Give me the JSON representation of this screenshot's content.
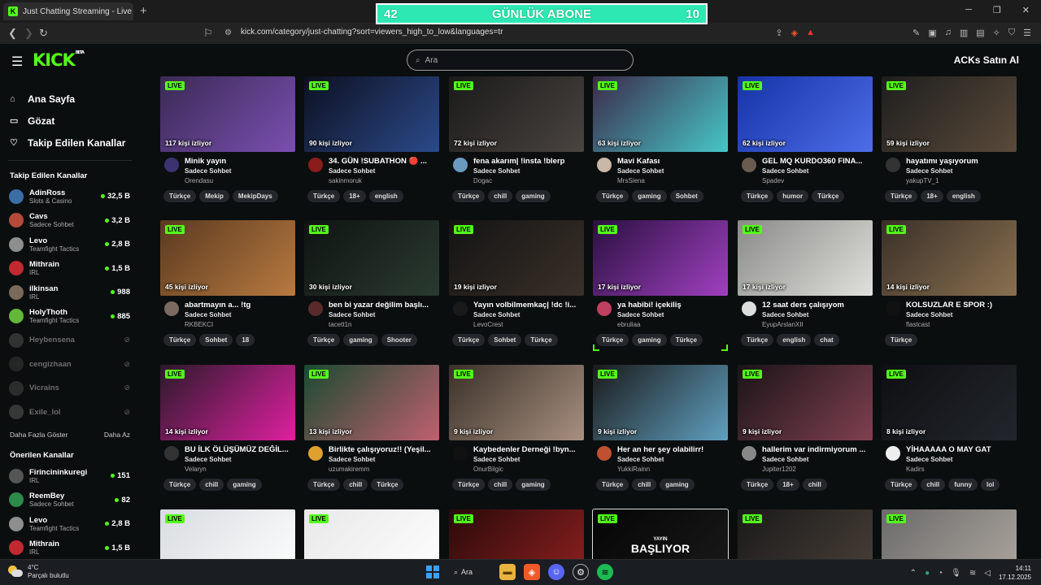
{
  "browser": {
    "tab_title": "Just Chatting Streaming - Live St",
    "favicon_letter": "K",
    "new_tab": "+",
    "url": "kick.com/category/just-chatting?sort=viewers_high_to_low&languages=tr",
    "window": {
      "minimize": "─",
      "restore": "❐",
      "close": "✕"
    }
  },
  "overlay_banner": {
    "left": "42",
    "label": "GÜNLÜK ABONE",
    "right": "10"
  },
  "site": {
    "logo": "KICK",
    "logo_sup": "BETA",
    "search_placeholder": "Ara",
    "user": "ACKs Satın Al"
  },
  "sidebar": {
    "nav": [
      {
        "label": "Ana Sayfa",
        "icon": "home-icon"
      },
      {
        "label": "Gözat",
        "icon": "browse-icon"
      },
      {
        "label": "Takip Edilen Kanallar",
        "icon": "heart-icon"
      }
    ],
    "followed_heading": "Takip Edilen Kanallar",
    "followed": [
      {
        "name": "AdinRoss",
        "category": "Slots & Casino",
        "viewers": "32,5 B",
        "color": "#3a6ea5"
      },
      {
        "name": "Cavs",
        "category": "Sadece Sohbet",
        "viewers": "3,2 B",
        "color": "#b54a3a"
      },
      {
        "name": "Levo",
        "category": "Teamfight Tactics",
        "viewers": "2,8 B",
        "color": "#8e8e8e"
      },
      {
        "name": "Mithrain",
        "category": "IRL",
        "viewers": "1,5 B",
        "color": "#c0292f"
      },
      {
        "name": "ilkinsan",
        "category": "IRL",
        "viewers": "988",
        "color": "#7a6a5a"
      },
      {
        "name": "HolyThoth",
        "category": "Teamfight Tactics",
        "viewers": "885",
        "color": "#62b83a"
      }
    ],
    "offline": [
      {
        "name": "Heybensena",
        "color": "#777"
      },
      {
        "name": "cengizhaan",
        "color": "#555"
      },
      {
        "name": "Vicrains",
        "color": "#666"
      },
      {
        "name": "Exile_lol",
        "color": "#888"
      }
    ],
    "show_more": "Daha Fazla Göster",
    "show_less": "Daha Az",
    "recommended_heading": "Önerilen Kanallar",
    "recommended": [
      {
        "name": "Firincininkuregi",
        "category": "IRL",
        "viewers": "151",
        "color": "#555"
      },
      {
        "name": "ReemBey",
        "category": "Sadece Sohbet",
        "viewers": "82",
        "color": "#2c8a4a"
      },
      {
        "name": "Levo",
        "category": "Teamfight Tactics",
        "viewers": "2,8 B",
        "color": "#8e8e8e"
      },
      {
        "name": "Mithrain",
        "category": "IRL",
        "viewers": "1,5 B",
        "color": "#c0292f"
      }
    ]
  },
  "live_label": "LIVE",
  "streams": [
    {
      "viewers": "117 kişi izliyor",
      "title": "Minik yayın",
      "category": "Sadece Sohbet",
      "user": "Orendasu",
      "tags": [
        "Türkçe",
        "Mekip",
        "MekipDays"
      ],
      "thumb": [
        "#3a2a55",
        "#7a4fb0"
      ],
      "avatar": "#3b3370"
    },
    {
      "viewers": "90 kişi izliyor",
      "title": "34. GÜN !SUBATHON 🔴 ...",
      "category": "Sadece Sohbet",
      "user": "sakinmoruk",
      "tags": [
        "Türkçe",
        "18+",
        "english"
      ],
      "thumb": [
        "#0d1020",
        "#2b4a8a"
      ],
      "avatar": "#8a1c1c"
    },
    {
      "viewers": "72 kişi izliyor",
      "title": "fena akarım| !insta !blerp",
      "category": "Sadece Sohbet",
      "user": "Dogac",
      "tags": [
        "Türkçe",
        "chill",
        "gaming"
      ],
      "thumb": [
        "#1a1a1a",
        "#4a4440"
      ],
      "avatar": "#6a9ac0"
    },
    {
      "viewers": "63 kişi izliyor",
      "title": "Mavi Kafası",
      "category": "Sadece Sohbet",
      "user": "MrsSiena",
      "tags": [
        "Türkçe",
        "gaming",
        "Sohbet"
      ],
      "thumb": [
        "#3c2a4a",
        "#46c6c8"
      ],
      "avatar": "#c9b7a7"
    },
    {
      "viewers": "62 kişi izliyor",
      "title": "GEL MQ KURDO360 FINA...",
      "category": "Sadece Sohbet",
      "user": "Spadev",
      "tags": [
        "Türkçe",
        "humor",
        "Türkçe"
      ],
      "thumb": [
        "#1633a8",
        "#4d6ee8"
      ],
      "avatar": "#6a5a50"
    },
    {
      "viewers": "59 kişi izliyor",
      "title": "hayatımı yaşıyorum",
      "category": "Sadece Sohbet",
      "user": "yakupTV_1",
      "tags": [
        "Türkçe",
        "18+",
        "english"
      ],
      "thumb": [
        "#1e1e1e",
        "#5a4a3a"
      ],
      "avatar": "#333"
    },
    {
      "viewers": "45 kişi izliyor",
      "title": "abartmayın a... !tg",
      "category": "Sadece Sohbet",
      "user": "RKBEKCI",
      "tags": [
        "Türkçe",
        "Sohbet",
        "18"
      ],
      "thumb": [
        "#5a3a20",
        "#b87a40"
      ],
      "avatar": "#7a6a60"
    },
    {
      "viewers": "30 kişi izliyor",
      "title": "ben bi yazar değilim başlı...",
      "category": "Sadece Sohbet",
      "user": "tacett1n",
      "tags": [
        "Türkçe",
        "gaming",
        "Shooter"
      ],
      "thumb": [
        "#0f1412",
        "#2a3a30"
      ],
      "avatar": "#5a2a2a"
    },
    {
      "viewers": "19 kişi izliyor",
      "title": "Yayın volbilmemkaç| !dc !i...",
      "category": "Sadece Sohbet",
      "user": "LevoCrest",
      "tags": [
        "Türkçe",
        "Sohbet",
        "Türkçe"
      ],
      "thumb": [
        "#141414",
        "#3a3028"
      ],
      "avatar": "#1a1a1a"
    },
    {
      "viewers": "17 kişi izliyor",
      "title": "ya habibi! içekiliş",
      "category": "Sadece Sohbet",
      "user": "ebruliaa",
      "tags": [
        "Türkçe",
        "gaming",
        "Türkçe"
      ],
      "thumb": [
        "#2a1040",
        "#a040c0"
      ],
      "avatar": "#c04060"
    },
    {
      "viewers": "17 kişi izliyor",
      "title": "12 saat ders çalışıyom",
      "category": "Sadece Sohbet",
      "user": "EyupArslanXII",
      "tags": [
        "Türkçe",
        "english",
        "chat"
      ],
      "thumb": [
        "#8a8a88",
        "#e0e0dc"
      ],
      "avatar": "#ddd"
    },
    {
      "viewers": "14 kişi izliyor",
      "title": "KOLSUZLAR E SPOR :)",
      "category": "Sadece Sohbet",
      "user": "flastcast",
      "tags": [
        "Türkçe"
      ],
      "thumb": [
        "#3a3028",
        "#8a7050"
      ],
      "avatar": "#111"
    },
    {
      "viewers": "14 kişi izliyor",
      "title": "BU İLK ÖLÜŞÜMÜZ DEĞİL...",
      "category": "Sadece Sohbet",
      "user": "Velaryn",
      "tags": [
        "Türkçe",
        "chill",
        "gaming"
      ],
      "thumb": [
        "#2a1a2a",
        "#e020a0"
      ],
      "avatar": "#333"
    },
    {
      "viewers": "13 kişi izliyor",
      "title": "Birlikte çalışıyoruz!! (Yeşil...",
      "category": "Sadece Sohbet",
      "user": "uzumakiremm",
      "tags": [
        "Türkçe",
        "chill",
        "Türkçe"
      ],
      "thumb": [
        "#1a4a30",
        "#c06070"
      ],
      "avatar": "#e0a030"
    },
    {
      "viewers": "9 kişi izliyor",
      "title": "Kaybedenler Derneği !byn...",
      "category": "Sadece Sohbet",
      "user": "OnurBilgic",
      "tags": [
        "Türkçe",
        "chill",
        "gaming"
      ],
      "thumb": [
        "#3a3028",
        "#a89080"
      ],
      "avatar": "#111"
    },
    {
      "viewers": "9 kişi izliyor",
      "title": "Her an her şey olabilirr!",
      "category": "Sadece Sohbet",
      "user": "YukkiRainn",
      "tags": [
        "Türkçe",
        "chill",
        "gaming"
      ],
      "thumb": [
        "#1a1a1a",
        "#60a0c0"
      ],
      "avatar": "#c05030"
    },
    {
      "viewers": "9 kişi izliyor",
      "title": "hallerim var indirmiyorum ...",
      "category": "Sadece Sohbet",
      "user": "Jupiter1202",
      "tags": [
        "Türkçe",
        "18+",
        "chill"
      ],
      "thumb": [
        "#1a1418",
        "#804050"
      ],
      "avatar": "#888"
    },
    {
      "viewers": "8 kişi izliyor",
      "title": "YİHAAAAA O MAY GAT",
      "category": "Sadece Sohbet",
      "user": "Kadirs",
      "tags": [
        "Türkçe",
        "chill",
        "funny",
        "lol"
      ],
      "thumb": [
        "#0e0f12",
        "#22262c"
      ],
      "avatar": "#eee"
    },
    {
      "thumb": [
        "#d8dce0",
        "#ffffff"
      ]
    },
    {
      "thumb": [
        "#e8e8e8",
        "#ffffff"
      ]
    },
    {
      "thumb": [
        "#2a0a0a",
        "#902020"
      ]
    },
    {
      "thumb": [
        "#050505",
        "#1a1a1a"
      ],
      "overlay_small": "YAYIN",
      "overlay_big": "BAŞLIYOR"
    },
    {
      "thumb": [
        "#1a1a1a",
        "#4a4038"
      ]
    },
    {
      "thumb": [
        "#6a6a6a",
        "#b0a8a0"
      ]
    }
  ],
  "taskbar": {
    "temp": "4°C",
    "weather": "Parçalı bulutlu",
    "search": "Ara",
    "time": "14:11",
    "date": "17.12.2025"
  },
  "colors": {
    "accent": "#53fc18",
    "background": "#0b0e0f"
  }
}
